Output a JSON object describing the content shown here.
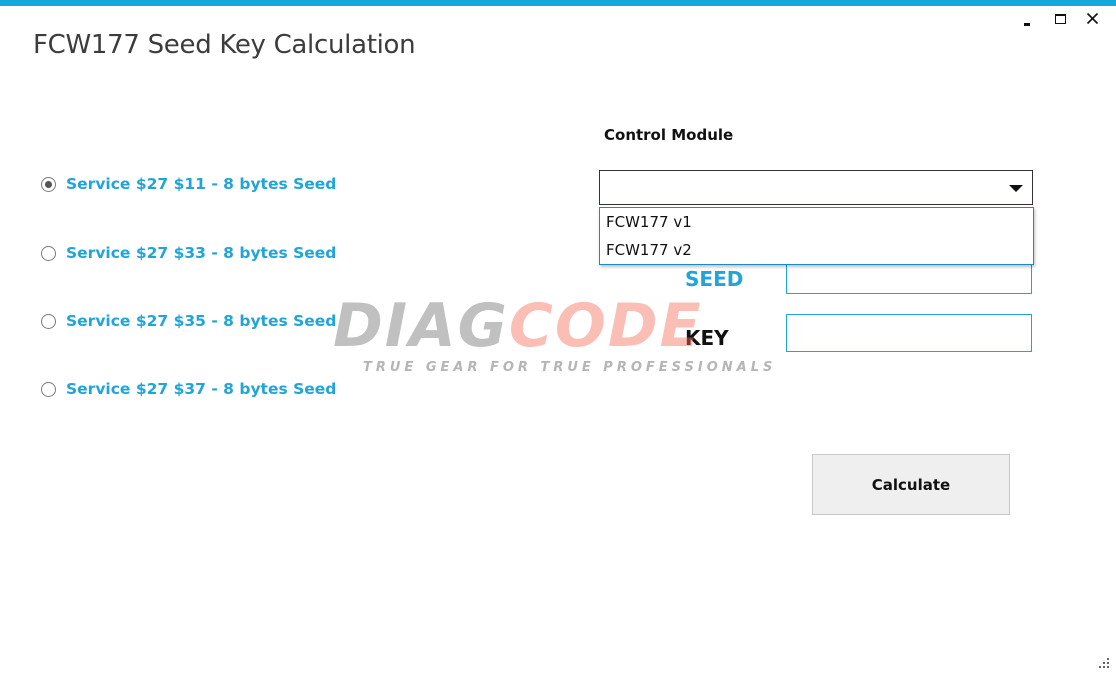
{
  "window": {
    "title": "FCW177 Seed Key Calculation",
    "accent_color": "#17a8db"
  },
  "services": [
    {
      "label": "Service $27 $11 - 8 bytes Seed",
      "selected": true
    },
    {
      "label": "Service $27 $33 - 8 bytes Seed",
      "selected": false
    },
    {
      "label": "Service $27 $35 - 8 bytes Seed",
      "selected": false
    },
    {
      "label": "Service $27 $37 - 8 bytes Seed",
      "selected": false
    }
  ],
  "control_module": {
    "label": "Control Module",
    "selected_value": "",
    "options": [
      "FCW177 v1",
      "FCW177 v2"
    ]
  },
  "seed": {
    "label": "SEED",
    "value": ""
  },
  "key": {
    "label": "KEY",
    "value": ""
  },
  "watermark": {
    "logo_part1": "DIAG",
    "logo_part2": "CODE",
    "tagline": "TRUE GEAR FOR TRUE PROFESSIONALS"
  },
  "actions": {
    "calculate_label": "Calculate"
  },
  "colors": {
    "service_label": "#21a5d8",
    "input_border": "#21a5d8",
    "dropdown_list_border": "#1a8cc4"
  }
}
